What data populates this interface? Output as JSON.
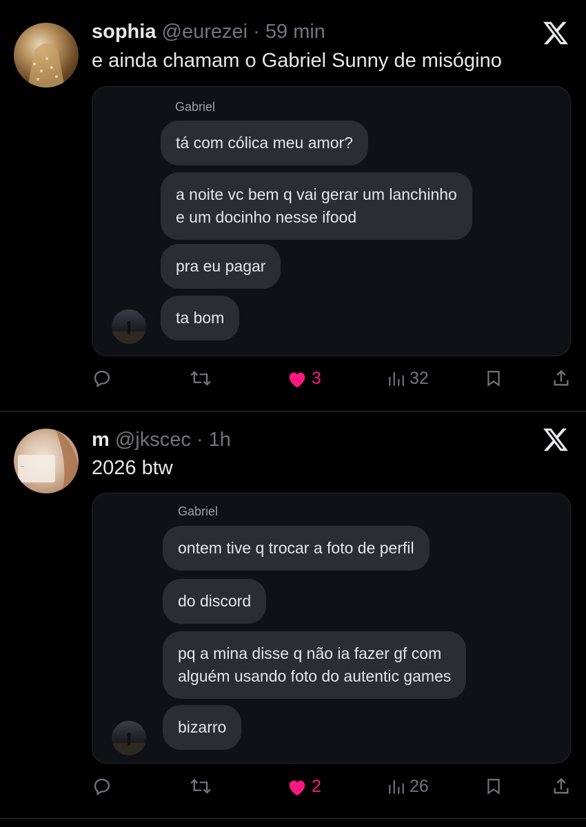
{
  "posts": [
    {
      "name": "sophia",
      "handle": "@eurezei",
      "dot": "·",
      "time": "59 min",
      "text": "e ainda chamam o Gabriel Sunny de misógino",
      "sender": "Gabriel",
      "messages": [
        "tá com cólica meu amor?",
        "a noite vc bem q vai gerar um lanchinho\ne um docinho nesse ifood",
        "pra eu pagar",
        "ta bom"
      ],
      "likes": "3",
      "views": "32"
    },
    {
      "name": "m",
      "handle": "@jkscec",
      "dot": "·",
      "time": "1h",
      "text": "2026 btw",
      "sender": "Gabriel",
      "messages": [
        "ontem tive q trocar a foto de perfil",
        "do discord",
        "pq a mina disse q não ia fazer gf com\nalguém usando foto do autentic games",
        "bizarro"
      ],
      "likes": "2",
      "views": "26"
    }
  ],
  "icons": {
    "logo": "x-logo-icon",
    "reply": "reply-icon",
    "repost": "repost-icon",
    "like": "heart-icon",
    "views": "views-icon",
    "bookmark": "bookmark-icon",
    "share": "share-icon"
  },
  "colors": {
    "like": "#f91880",
    "muted": "#71767b",
    "text": "#e7e9ea",
    "background": "#000000"
  }
}
